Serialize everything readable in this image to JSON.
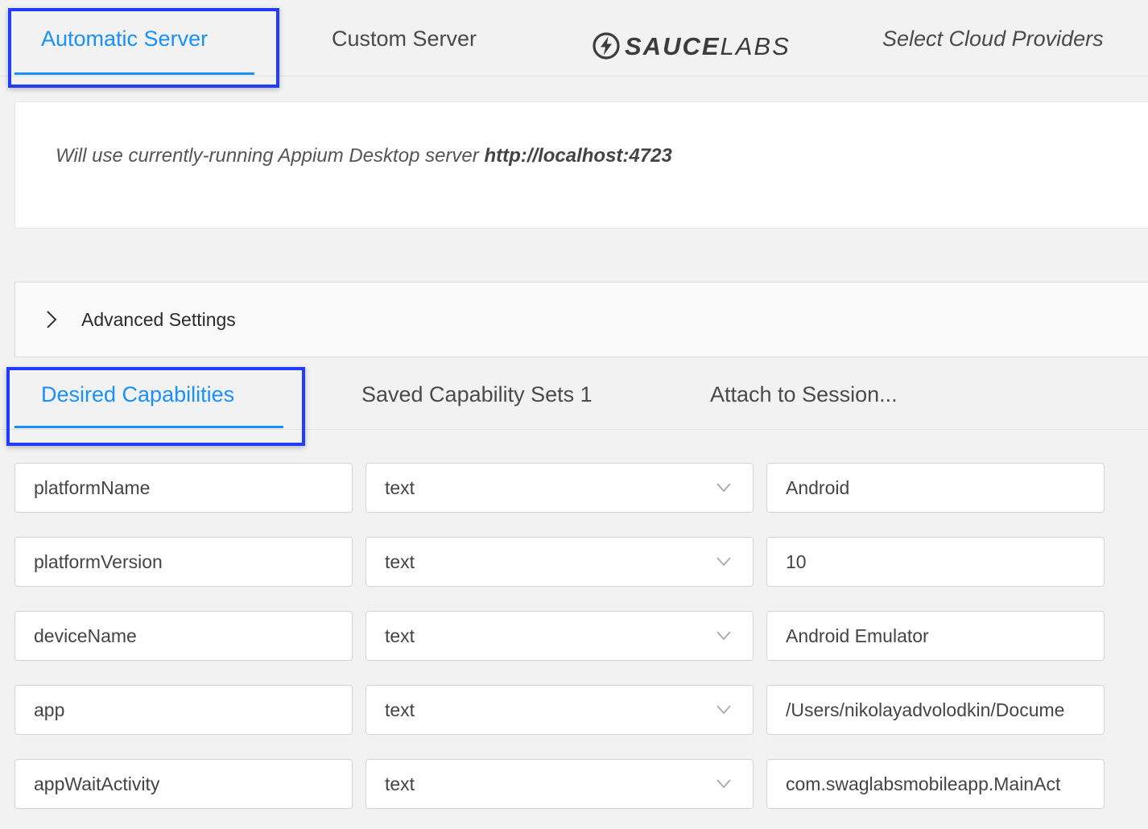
{
  "server_tabs": {
    "automatic": "Automatic Server",
    "custom": "Custom Server",
    "sauce_bold": "SAUCE",
    "sauce_light": "LABS",
    "cloud": "Select Cloud Providers"
  },
  "server_info": {
    "prefix": "Will use currently-running Appium Desktop server ",
    "url": "http://localhost:4723"
  },
  "advanced": {
    "label": "Advanced Settings"
  },
  "cap_tabs": {
    "desired": "Desired Capabilities",
    "saved": "Saved Capability Sets 1",
    "attach": "Attach to Session..."
  },
  "capabilities": [
    {
      "name": "platformName",
      "type": "text",
      "value": "Android"
    },
    {
      "name": "platformVersion",
      "type": "text",
      "value": "10"
    },
    {
      "name": "deviceName",
      "type": "text",
      "value": "Android Emulator"
    },
    {
      "name": "app",
      "type": "text",
      "value": "/Users/nikolayadvolodkin/Docume"
    },
    {
      "name": "appWaitActivity",
      "type": "text",
      "value": "com.swaglabsmobileapp.MainAct"
    }
  ],
  "colors": {
    "accent": "#1890ff",
    "highlight": "#1f3cff",
    "background": "#f2f2f2"
  },
  "icons": {
    "sauce_logo": "sauce-labs-bolt-icon",
    "advanced": "chevron-right-icon",
    "select": "chevron-down-icon"
  }
}
